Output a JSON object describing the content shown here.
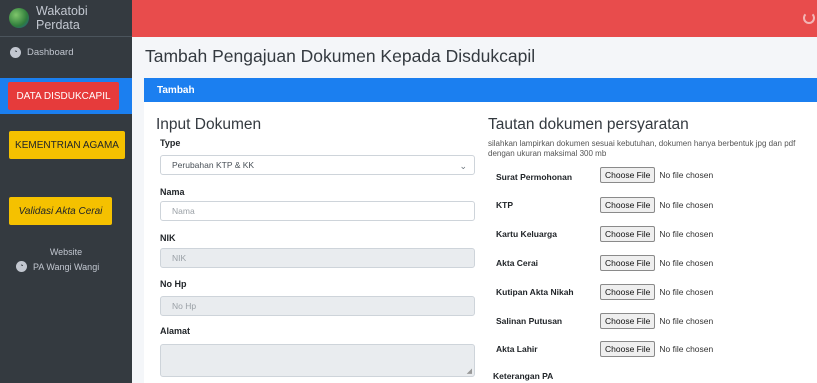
{
  "app": {
    "title": "Wakatobi Perdata"
  },
  "sidebar": {
    "dashboard": "Dashboard",
    "btn_disdukcapil": "DATA DISDUKCAPIL",
    "btn_kemenag": "KEMENTRIAN AGAMA",
    "btn_validasi": "Validasi Akta Cerai",
    "website_label": "Website",
    "website_link": "PA Wangi Wangi"
  },
  "page": {
    "title": "Tambah Pengajuan Dokumen Kepada Disdukcapil"
  },
  "card": {
    "header": "Tambah"
  },
  "input_section": {
    "title": "Input Dokumen",
    "type_label": "Type",
    "type_value": "Perubahan KTP & KK",
    "nama_label": "Nama",
    "nama_placeholder": "Nama",
    "nik_label": "NIK",
    "nik_placeholder": "NIK",
    "nohp_label": "No Hp",
    "nohp_placeholder": "No Hp",
    "alamat_label": "Alamat"
  },
  "docs_section": {
    "title": "Tautan dokumen persyaratan",
    "note": "silahkan lampirkan dokumen sesuai kebutuhan, dokumen hanya berbentuk jpg dan pdf dengan ukuran maksimal 300 mb",
    "choose_label": "Choose File",
    "no_file": "No file chosen",
    "items": [
      "Surat Permohonan",
      "KTP",
      "Kartu Keluarga",
      "Akta Cerai",
      "Kutipan Akta Nikah",
      "Salinan Putusan",
      "Akta Lahir"
    ],
    "keterangan_label": "Keterangan PA"
  },
  "colors": {
    "topbar": "#e84c4c",
    "primary": "#1b7ff0",
    "danger": "#e63b3b",
    "warning": "#f5c100",
    "sidebar": "#343a40"
  }
}
